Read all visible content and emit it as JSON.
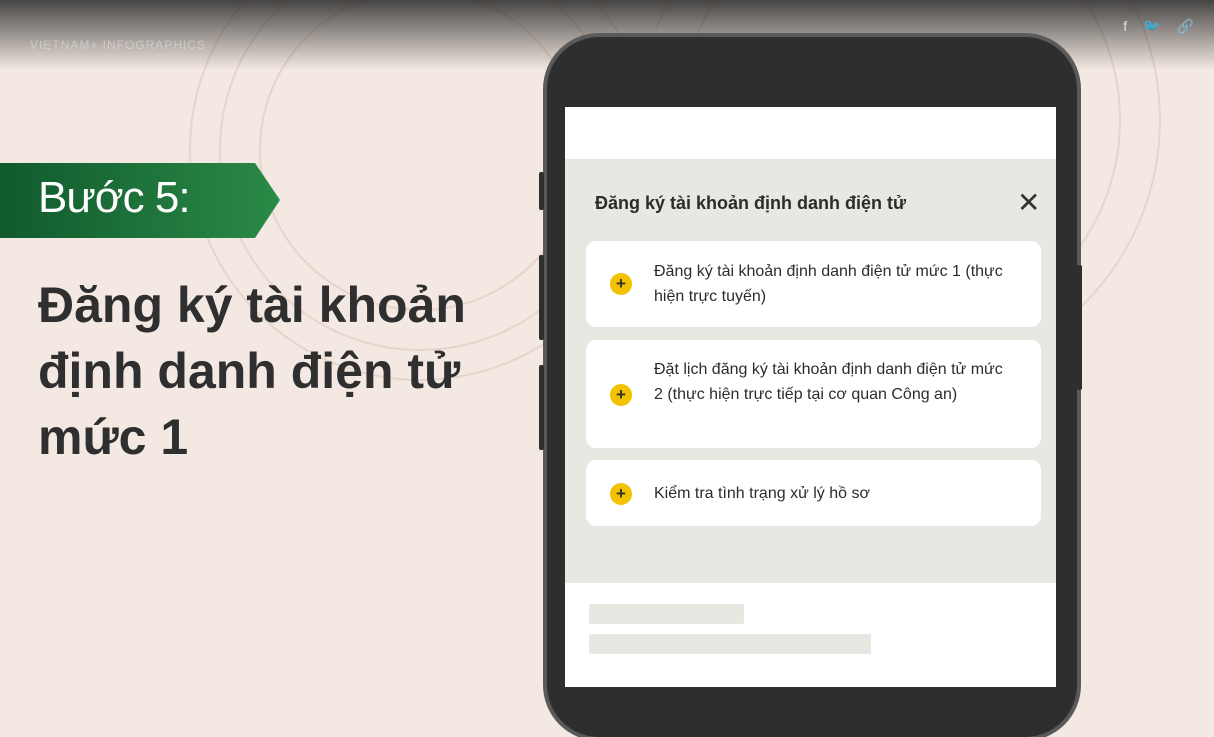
{
  "header": {
    "logo_text": "VIETNAM+ INFOGRAPHICS",
    "share": [
      {
        "name": "facebook-icon",
        "glyph": "f"
      },
      {
        "name": "twitter-icon",
        "glyph": "🐦"
      },
      {
        "name": "link-icon",
        "glyph": "🔗"
      }
    ]
  },
  "step": {
    "label": "Bước 5:",
    "title": "Đăng ký tài khoản định danh điện tử mức 1"
  },
  "modal": {
    "title": "Đăng ký tài khoản định danh điện tử",
    "close_glyph": "✕",
    "options": [
      {
        "label": "Đăng ký tài khoản  định danh điện tử mức 1 (thực hiện trực tuyến)"
      },
      {
        "label": "Đặt lịch đăng ký tài khoản định danh điện tử mức 2 (thực hiện trực tiếp tại cơ quan Công an)"
      },
      {
        "label": "Kiểm tra tình trạng xử lý hồ sơ"
      }
    ],
    "option_icon": "+"
  },
  "colors": {
    "banner_green": "#1d6e3c",
    "accent_yellow": "#f2c100",
    "background": "#f3e9e2"
  }
}
